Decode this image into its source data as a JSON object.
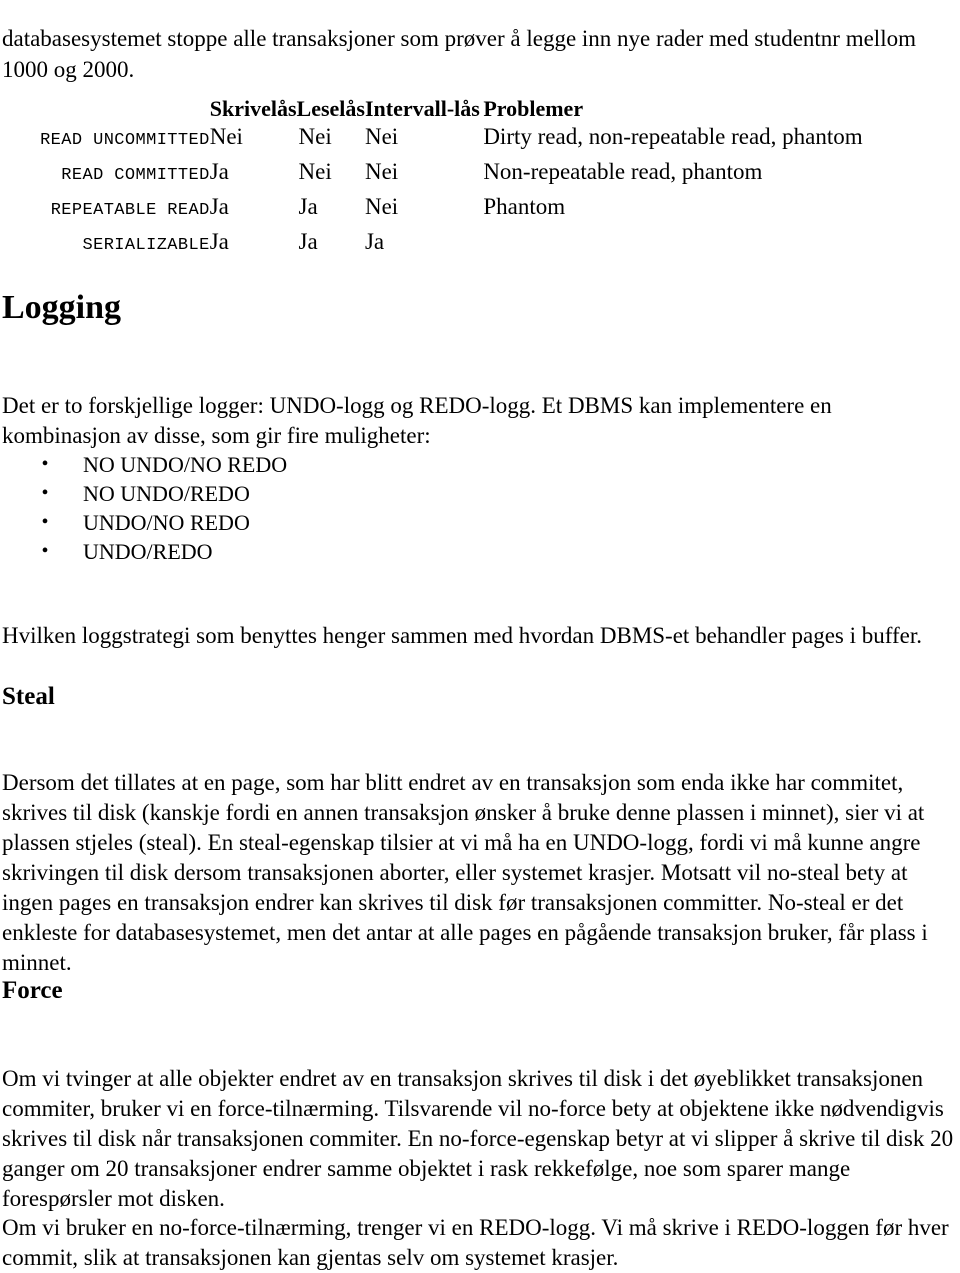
{
  "document": {
    "intro_paragraph": "databasesystemet stoppe alle transaksjoner som prøver å legge inn nye rader med studentnr mellom 1000 og 2000."
  },
  "isolation_table": {
    "headers": {
      "level": "",
      "write_lock": "Skrivelås",
      "read_lock": "Leselås",
      "range_lock": "Intervall-lås",
      "problems": "Problemer"
    },
    "rows": [
      {
        "level": "READ UNCOMMITTED",
        "write_lock": "Nei",
        "read_lock": "Nei",
        "range_lock": "Nei",
        "problems": "Dirty read, non-repeatable read, phantom"
      },
      {
        "level": "READ COMMITTED",
        "write_lock": "Ja",
        "read_lock": "Nei",
        "range_lock": "Nei",
        "problems": "Non-repeatable read, phantom"
      },
      {
        "level": "REPEATABLE READ",
        "write_lock": "Ja",
        "read_lock": "Ja",
        "range_lock": "Nei",
        "problems": "Phantom"
      },
      {
        "level": "SERIALIZABLE",
        "write_lock": "Ja",
        "read_lock": "Ja",
        "range_lock": "Ja",
        "problems": ""
      }
    ]
  },
  "logging_section": {
    "heading": "Logging",
    "intro": "Det er to forskjellige logger: UNDO-logg og REDO-logg. Et DBMS kan implementere en kombinasjon av disse, som gir fire muligheter:",
    "bullets": [
      "NO UNDO/NO REDO",
      "NO UNDO/REDO",
      "UNDO/NO REDO",
      "UNDO/REDO"
    ],
    "bullet_glyph": "•",
    "closing": "Hvilken loggstrategi som benyttes henger sammen med hvordan DBMS-et behandler pages i buffer."
  },
  "steal_section": {
    "heading": "Steal",
    "paragraph": "Dersom det tillates at en page, som har blitt endret av en transaksjon som enda ikke har commitet, skrives til disk (kanskje fordi en annen transaksjon ønsker å bruke denne plassen i minnet), sier vi at plassen stjeles (steal). En steal-egenskap tilsier at vi må ha en UNDO-logg, fordi vi må kunne angre skrivingen til disk dersom transaksjonen aborter, eller systemet krasjer. Motsatt vil no-steal bety at ingen pages en transaksjon endrer kan skrives til disk før transaksjonen committer. No-steal er det enkleste for databasesystemet, men det antar at alle pages en pågående transaksjon bruker, får plass i minnet."
  },
  "force_section": {
    "heading": "Force",
    "paragraph_1": "Om vi tvinger at alle objekter endret av en transaksjon skrives til disk i det øyeblikket transaksjonen commiter, bruker vi en force-tilnærming. Tilsvarende vil no-force bety at objektene ikke nødvendigvis skrives til disk når transaksjonen commiter. En no-force-egenskap betyr at vi slipper å skrive til disk 20 ganger om 20 transaksjoner endrer samme objektet i rask rekkefølge, noe som sparer mange forespørsler mot disken.",
    "paragraph_2": "Om vi bruker en no-force-tilnærming, trenger vi en REDO-logg. Vi må skrive i REDO-loggen før hver commit, slik at transaksjonen kan gjentas selv om systemet krasjer."
  }
}
